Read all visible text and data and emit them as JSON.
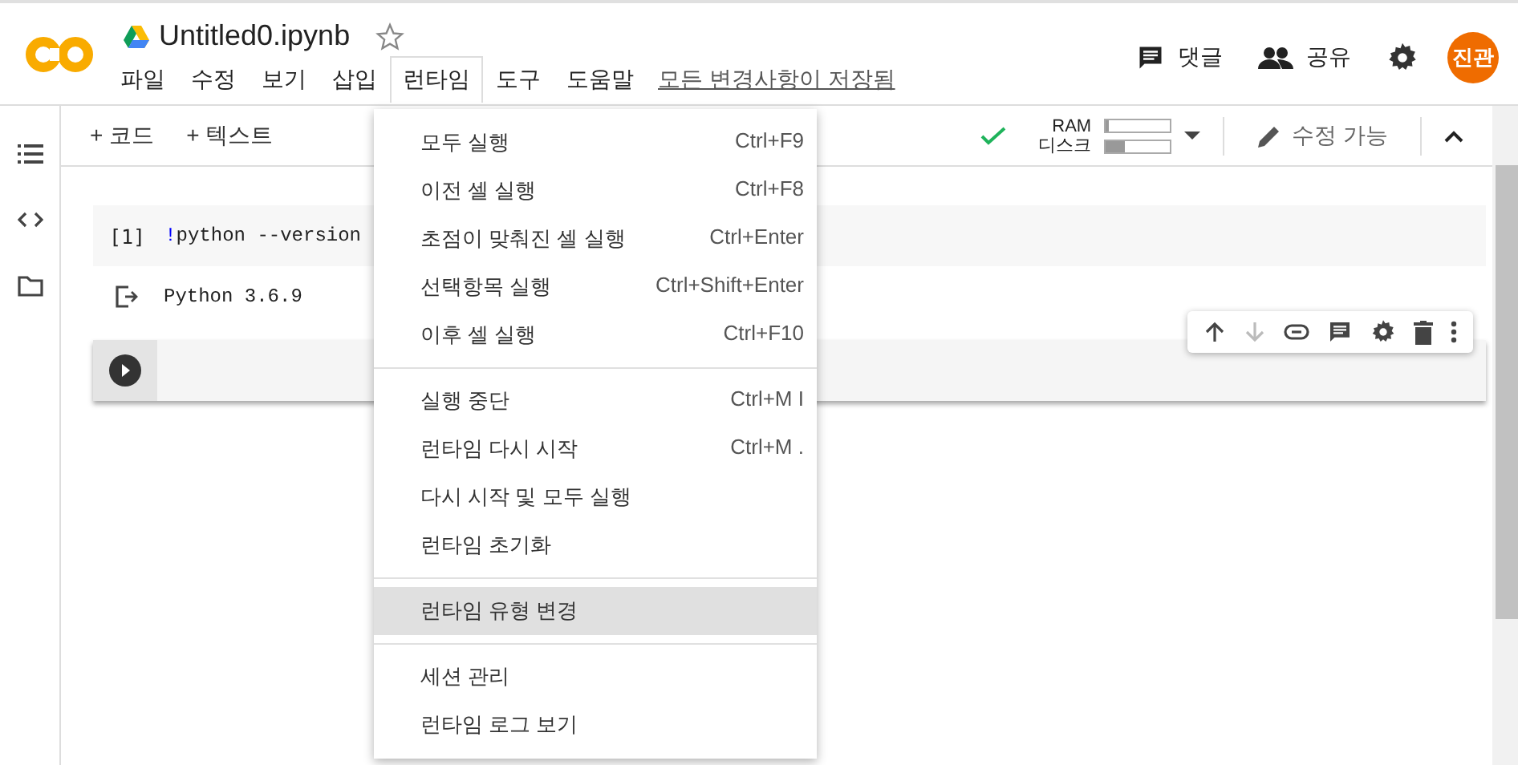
{
  "header": {
    "title": "Untitled0.ipynb",
    "starred": false,
    "comment_label": "댓글",
    "share_label": "공유",
    "avatar": "진관"
  },
  "menus": [
    {
      "label": "파일",
      "selected": false
    },
    {
      "label": "수정",
      "selected": false
    },
    {
      "label": "보기",
      "selected": false
    },
    {
      "label": "삽입",
      "selected": false
    },
    {
      "label": "런타임",
      "selected": true
    },
    {
      "label": "도구",
      "selected": false
    },
    {
      "label": "도움말",
      "selected": false
    }
  ],
  "save_status": "모든 변경사항이 저장됨",
  "toolbar": {
    "add_code": "+ 코드",
    "add_text": "+ 텍스트",
    "ram_label": "RAM",
    "disk_label": "디스크",
    "ram": {
      "level": 0.04
    },
    "disk": {
      "level": 0.3
    },
    "edit_label": "수정 가능"
  },
  "cells": [
    {
      "kind": "code",
      "exec_count": "[1]",
      "bang": "!",
      "code": "python --version",
      "output": "Python 3.6.9"
    },
    {
      "kind": "empty"
    }
  ],
  "runtime_menu": [
    [
      {
        "label": "모두 실행",
        "shortcut": "Ctrl+F9",
        "selected": false
      },
      {
        "label": "이전 셀 실행",
        "shortcut": "Ctrl+F8",
        "selected": false
      },
      {
        "label": "초점이 맞춰진 셀 실행",
        "shortcut": "Ctrl+Enter",
        "selected": false
      },
      {
        "label": "선택항목 실행",
        "shortcut": "Ctrl+Shift+Enter",
        "selected": false
      },
      {
        "label": "이후 셀 실행",
        "shortcut": "Ctrl+F10",
        "selected": false
      }
    ],
    [
      {
        "label": "실행 중단",
        "shortcut": "Ctrl+M I",
        "selected": false
      },
      {
        "label": "런타임 다시 시작",
        "shortcut": "Ctrl+M .",
        "selected": false
      },
      {
        "label": "다시 시작 및 모두 실행",
        "selected": false
      },
      {
        "label": "런타임 초기화",
        "selected": false
      }
    ],
    [
      {
        "label": "런타임 유형 변경",
        "selected": true
      }
    ],
    [
      {
        "label": "세션 관리",
        "selected": false
      },
      {
        "label": "런타임 로그 보기",
        "selected": false
      }
    ]
  ]
}
